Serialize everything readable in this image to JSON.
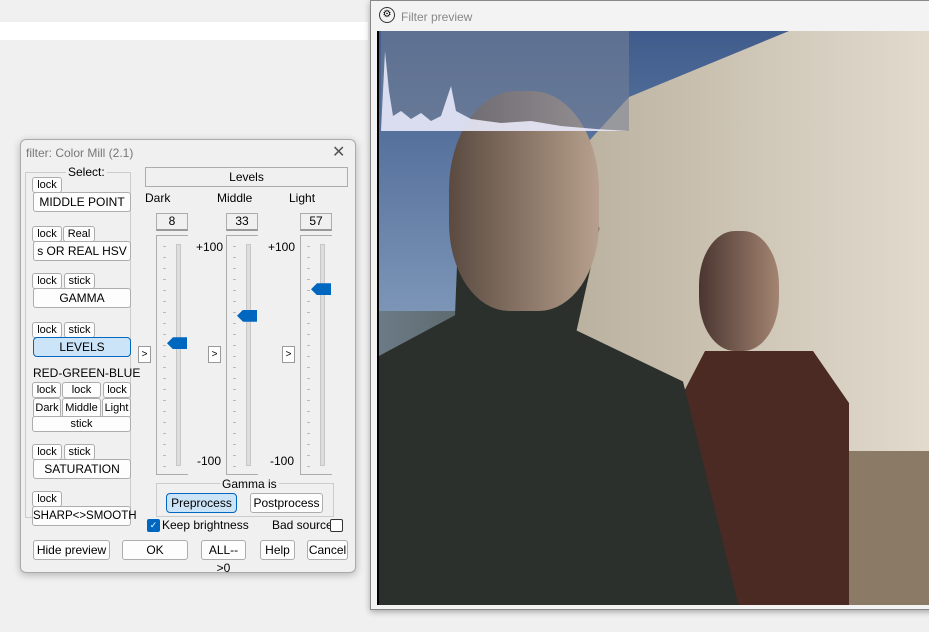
{
  "preview": {
    "title": "Filter preview",
    "icon": "gear-icon"
  },
  "dialog": {
    "title": "filter: Color Mill (2.1)",
    "select_label": "Select:",
    "groups": [
      {
        "buttons": [
          "lock"
        ],
        "name": "MIDDLE POINT"
      },
      {
        "buttons": [
          "lock",
          "Real"
        ],
        "name": "s OR REAL HSV"
      },
      {
        "buttons": [
          "lock",
          "stick"
        ],
        "name": "GAMMA"
      },
      {
        "buttons": [
          "lock",
          "stick"
        ],
        "name": "LEVELS",
        "selected": true
      },
      {
        "label": "RED-GREEN-BLUE",
        "locks": [
          "lock",
          "lock",
          "lock"
        ],
        "channels": [
          "Dark",
          "Middle",
          "Light"
        ],
        "stick": "stick"
      },
      {
        "buttons": [
          "lock",
          "stick"
        ],
        "name": "SATURATION"
      },
      {
        "buttons": [
          "lock"
        ],
        "name": "SHARP<>SMOOTH"
      }
    ],
    "section_title": "Levels",
    "sliders": [
      {
        "label": "Dark",
        "value": 8,
        "value_text": "8"
      },
      {
        "label": "Middle",
        "value": 33,
        "value_text": "33"
      },
      {
        "label": "Light",
        "value": 57,
        "value_text": "57"
      }
    ],
    "scale_max": "+100",
    "scale_min": "-100",
    "gamma_label": "Gamma is",
    "preprocess": "Preprocess",
    "postprocess": "Postprocess",
    "keep_brightness": {
      "label": "Keep brightness",
      "checked": true
    },
    "bad_source": {
      "label": "Bad source",
      "checked": false
    },
    "footer": {
      "hide_preview": "Hide preview",
      "ok": "OK",
      "all_zero": "ALL-->0",
      "help": "Help",
      "cancel": "Cancel"
    },
    "arrow": ">",
    "accent": "#0067c0"
  }
}
